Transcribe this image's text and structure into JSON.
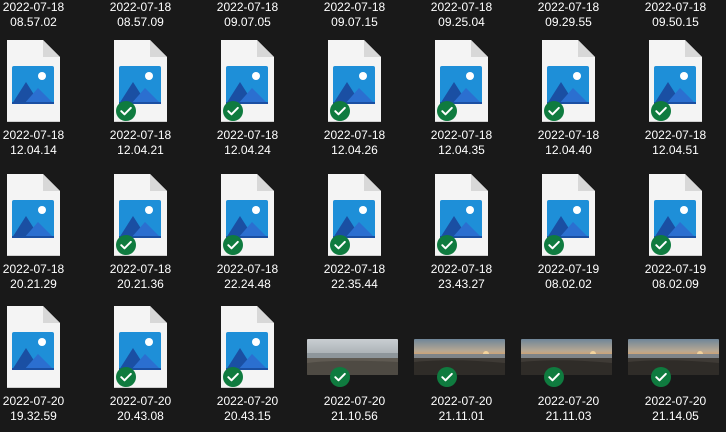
{
  "files": {
    "row0": [
      {
        "label": "2022-07-18\n08.57.02",
        "synced": false
      },
      {
        "label": "2022-07-18\n08.57.09",
        "synced": false
      },
      {
        "label": "2022-07-18\n09.07.05",
        "synced": false
      },
      {
        "label": "2022-07-18\n09.07.15",
        "synced": false
      },
      {
        "label": "2022-07-18\n09.25.04",
        "synced": false
      },
      {
        "label": "2022-07-18\n09.29.55",
        "synced": false
      },
      {
        "label": "2022-07-18\n09.50.15",
        "synced": false
      }
    ],
    "row1": [
      {
        "label": "2022-07-18\n12.04.14",
        "synced": false
      },
      {
        "label": "2022-07-18\n12.04.21",
        "synced": true
      },
      {
        "label": "2022-07-18\n12.04.24",
        "synced": true
      },
      {
        "label": "2022-07-18\n12.04.26",
        "synced": true
      },
      {
        "label": "2022-07-18\n12.04.35",
        "synced": true
      },
      {
        "label": "2022-07-18\n12.04.40",
        "synced": true
      },
      {
        "label": "2022-07-18\n12.04.51",
        "synced": true
      }
    ],
    "row2": [
      {
        "label": "2022-07-18\n20.21.29",
        "synced": false
      },
      {
        "label": "2022-07-18\n20.21.36",
        "synced": true
      },
      {
        "label": "2022-07-18\n22.24.48",
        "synced": true
      },
      {
        "label": "2022-07-18\n22.35.44",
        "synced": true
      },
      {
        "label": "2022-07-18\n23.43.27",
        "synced": true
      },
      {
        "label": "2022-07-19\n08.02.02",
        "synced": true
      },
      {
        "label": "2022-07-19\n08.02.09",
        "synced": true
      }
    ],
    "row3": [
      {
        "label": "2022-07-20\n19.32.59",
        "synced": false,
        "kind": "icon"
      },
      {
        "label": "2022-07-20\n20.43.08",
        "synced": true,
        "kind": "icon"
      },
      {
        "label": "2022-07-20\n20.43.15",
        "synced": true,
        "kind": "icon"
      },
      {
        "label": "2022-07-20\n21.10.56",
        "synced": true,
        "kind": "photo",
        "photo": "overcast-beach"
      },
      {
        "label": "2022-07-20\n21.11.01",
        "synced": true,
        "kind": "photo",
        "photo": "sunset-beach"
      },
      {
        "label": "2022-07-20\n21.11.03",
        "synced": true,
        "kind": "photo",
        "photo": "sunset-beach"
      },
      {
        "label": "2022-07-20\n21.14.05",
        "synced": true,
        "kind": "photo",
        "photo": "sunset-beach"
      }
    ]
  },
  "icons": {
    "file": "image-file-icon",
    "status": "sync-check-icon"
  },
  "colors": {
    "background": "#191919",
    "sync_green": "#0f7b3f",
    "page_white": "#f4f4f4",
    "image_blue": "#1e8fd8"
  }
}
